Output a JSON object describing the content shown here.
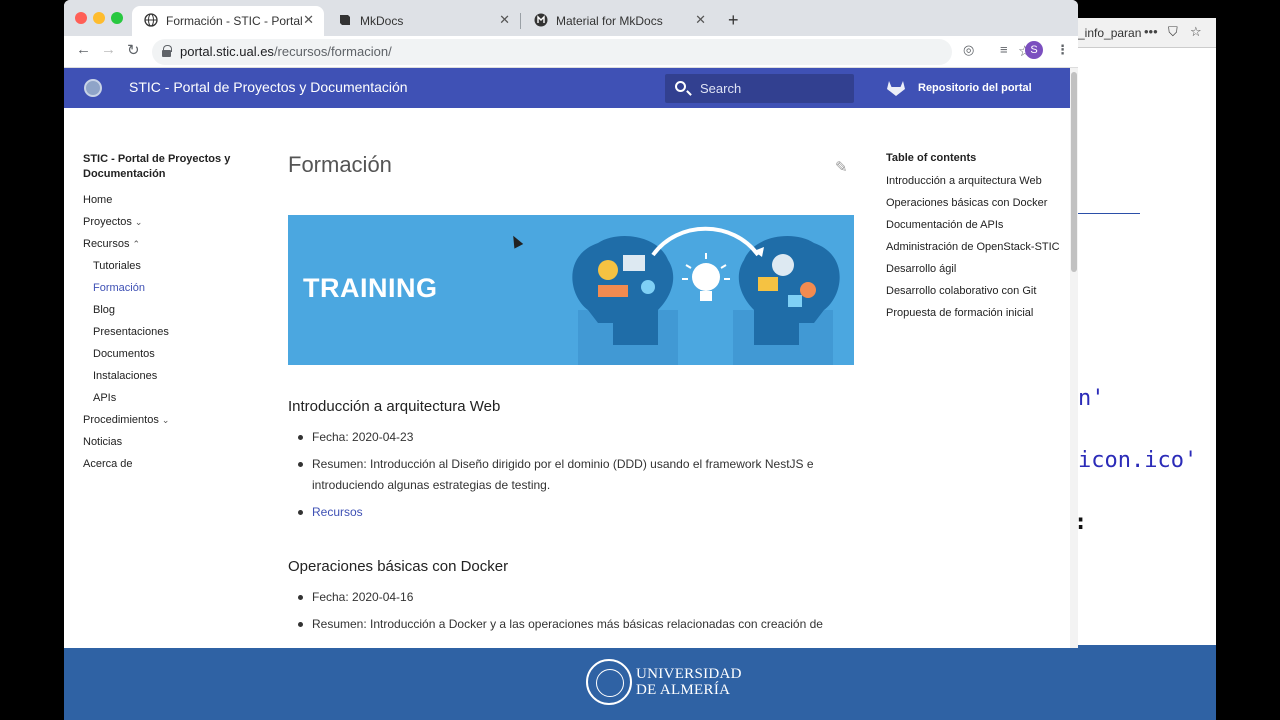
{
  "background": {
    "editor_fragment": "_info_paran",
    "code_fragment_1": "n'",
    "code_fragment_2": "icon.ico'",
    "code_fragment_3": ":",
    "university_line1": "UNIVERSIDAD",
    "university_line2": "DE ALMERÍA"
  },
  "browser": {
    "tabs": [
      {
        "title": "Formación - STIC - Portal de Proyectos y Documentación",
        "icon": "globe-icon",
        "active": true
      },
      {
        "title": "MkDocs",
        "icon": "book-icon",
        "active": false
      },
      {
        "title": "Material for MkDocs",
        "icon": "material-icon",
        "active": false
      }
    ],
    "new_tab": "+",
    "close_glyph": "✕",
    "url_host": "portal.stic.ual.es",
    "url_path": "/recursos/formacion/",
    "profile_initial": "S"
  },
  "site": {
    "title": "STIC - Portal de Proyectos y Documentación",
    "search_placeholder": "Search",
    "repo_label": "Repositorio del portal",
    "accent_color": "#3f51b5"
  },
  "nav": {
    "title": "STIC - Portal de Proyectos y Documentación",
    "items": [
      {
        "label": "Home",
        "level": 0
      },
      {
        "label": "Proyectos",
        "level": 0,
        "chevron": "⌄"
      },
      {
        "label": "Recursos",
        "level": 0,
        "chevron": "⌃"
      },
      {
        "label": "Tutoriales",
        "level": 1
      },
      {
        "label": "Formación",
        "level": 1,
        "active": true
      },
      {
        "label": "Blog",
        "level": 1
      },
      {
        "label": "Presentaciones",
        "level": 1
      },
      {
        "label": "Documentos",
        "level": 1
      },
      {
        "label": "Instalaciones",
        "level": 1
      },
      {
        "label": "APIs",
        "level": 1
      },
      {
        "label": "Procedimientos",
        "level": 0,
        "chevron": "⌄"
      },
      {
        "label": "Noticias",
        "level": 0
      },
      {
        "label": "Acerca de",
        "level": 0
      }
    ]
  },
  "main": {
    "page_title": "Formación",
    "hero_text": "TRAINING",
    "sections": [
      {
        "heading": "Introducción a arquitectura Web",
        "date": "Fecha: 2020-04-23",
        "summary": "Resumen: Introducción al Diseño dirigido por el dominio (DDD) usando el framework NestJS e introduciendo algunas estrategias de testing.",
        "link": "Recursos"
      },
      {
        "heading": "Operaciones básicas con Docker",
        "date": "Fecha: 2020-04-16",
        "summary": "Resumen: Introducción a Docker y a las operaciones más básicas relacionadas con creación de"
      }
    ]
  },
  "toc": {
    "title": "Table of contents",
    "items": [
      "Introducción a arquitectura Web",
      "Operaciones básicas con Docker",
      "Documentación de APIs",
      "Administración de OpenStack-STIC",
      "Desarrollo ágil",
      "Desarrollo colaborativo con Git",
      "Propuesta de formación inicial"
    ]
  }
}
